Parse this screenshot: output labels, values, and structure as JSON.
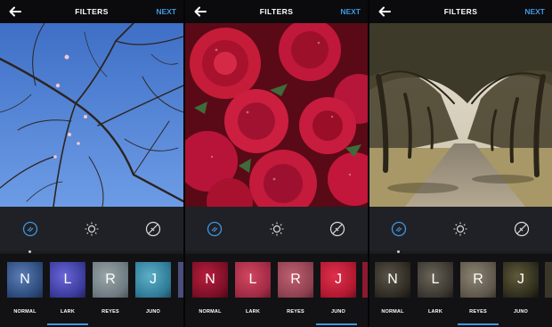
{
  "accent_color": "#3f97e0",
  "screens": [
    {
      "title": "FILTERS",
      "next_label": "NEXT",
      "photo": "blue sky with bare tree branches and pink buds",
      "filters": [
        {
          "letter": "N",
          "name": "NORMAL"
        },
        {
          "letter": "L",
          "name": "LARK"
        },
        {
          "letter": "R",
          "name": "REYES"
        },
        {
          "letter": "J",
          "name": "JUNO"
        }
      ]
    },
    {
      "title": "FILTERS",
      "next_label": "NEXT",
      "photo": "red roses with water droplets",
      "filters": [
        {
          "letter": "N",
          "name": "NORMAL"
        },
        {
          "letter": "L",
          "name": "LARK"
        },
        {
          "letter": "R",
          "name": "REYES"
        },
        {
          "letter": "J",
          "name": "JUNO"
        }
      ]
    },
    {
      "title": "FILTERS",
      "next_label": "NEXT",
      "photo": "road through a tunnel of cypress trees",
      "filters": [
        {
          "letter": "N",
          "name": "NORMAL"
        },
        {
          "letter": "L",
          "name": "LARK"
        },
        {
          "letter": "R",
          "name": "REYES"
        },
        {
          "letter": "J",
          "name": "JUNO"
        }
      ]
    }
  ],
  "icons": {
    "back": "back-arrow-icon",
    "filter_tool": "filter-lux-icon",
    "brightness_tool": "brightness-icon",
    "edit_tool": "adjust-slash-icon"
  }
}
